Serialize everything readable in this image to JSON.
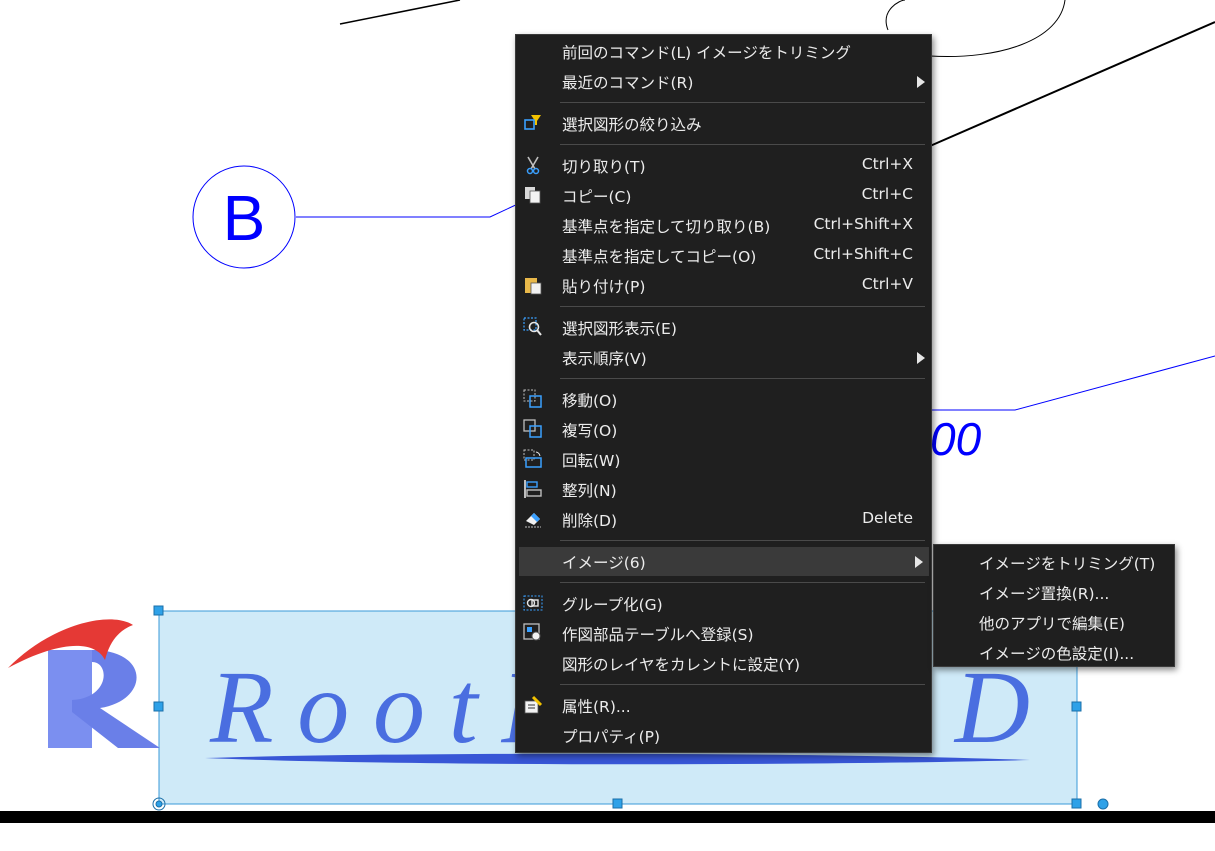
{
  "context_menu": {
    "items": [
      {
        "label": "前回のコマンド(L)  イメージをトリミング",
        "icon": "none"
      },
      {
        "label": "最近のコマンド(R)",
        "submenu": true
      },
      {
        "label": "選択図形の絞り込み",
        "icon": "filter-icon"
      },
      {
        "label": "切り取り(T)",
        "shortcut": "Ctrl+X",
        "icon": "scissors-icon"
      },
      {
        "label": "コピー(C)",
        "shortcut": "Ctrl+C",
        "icon": "copy-icon"
      },
      {
        "label": "基準点を指定して切り取り(B)",
        "shortcut": "Ctrl+Shift+X"
      },
      {
        "label": "基準点を指定してコピー(O)",
        "shortcut": "Ctrl+Shift+C"
      },
      {
        "label": "貼り付け(P)",
        "shortcut": "Ctrl+V",
        "icon": "paste-icon"
      },
      {
        "label": "選択図形表示(E)",
        "icon": "zoom-selection-icon"
      },
      {
        "label": "表示順序(V)",
        "submenu": true
      },
      {
        "label": "移動(O)",
        "icon": "move-icon"
      },
      {
        "label": "複写(O)",
        "icon": "duplicate-icon"
      },
      {
        "label": "回転(W)",
        "icon": "rotate-icon"
      },
      {
        "label": "整列(N)",
        "icon": "align-icon"
      },
      {
        "label": "削除(D)",
        "shortcut": "Delete",
        "icon": "eraser-icon"
      },
      {
        "label": "イメージ(6)",
        "submenu": true,
        "highlighted": true
      },
      {
        "label": "グループ化(G)",
        "icon": "group-icon"
      },
      {
        "label": "作図部品テーブルへ登録(S)",
        "icon": "parts-table-icon"
      },
      {
        "label": "図形のレイヤをカレントに設定(Y)"
      },
      {
        "label": "属性(R)...",
        "icon": "attribute-icon"
      },
      {
        "label": "プロパティ(P)"
      }
    ]
  },
  "image_submenu": {
    "items": [
      {
        "label": "イメージをトリミング(T)"
      },
      {
        "label": "イメージ置換(R)..."
      },
      {
        "label": "他のアプリで編集(E)"
      },
      {
        "label": "イメージの色設定(I)..."
      }
    ]
  },
  "drawing": {
    "grid_bubble_label": "B",
    "dimension_fragment": "00",
    "logo_text": "RootPro CAD"
  },
  "colors": {
    "menu_bg": "#1f1f1f",
    "menu_text": "#ececec",
    "highlight": "#3a3a3a",
    "cad_blue": "#0000ff",
    "selection_fill": "#cfeaf8",
    "selection_border": "#3a9ad9",
    "logo_blue": "#4a6ee0",
    "logo_red": "#e53935"
  }
}
